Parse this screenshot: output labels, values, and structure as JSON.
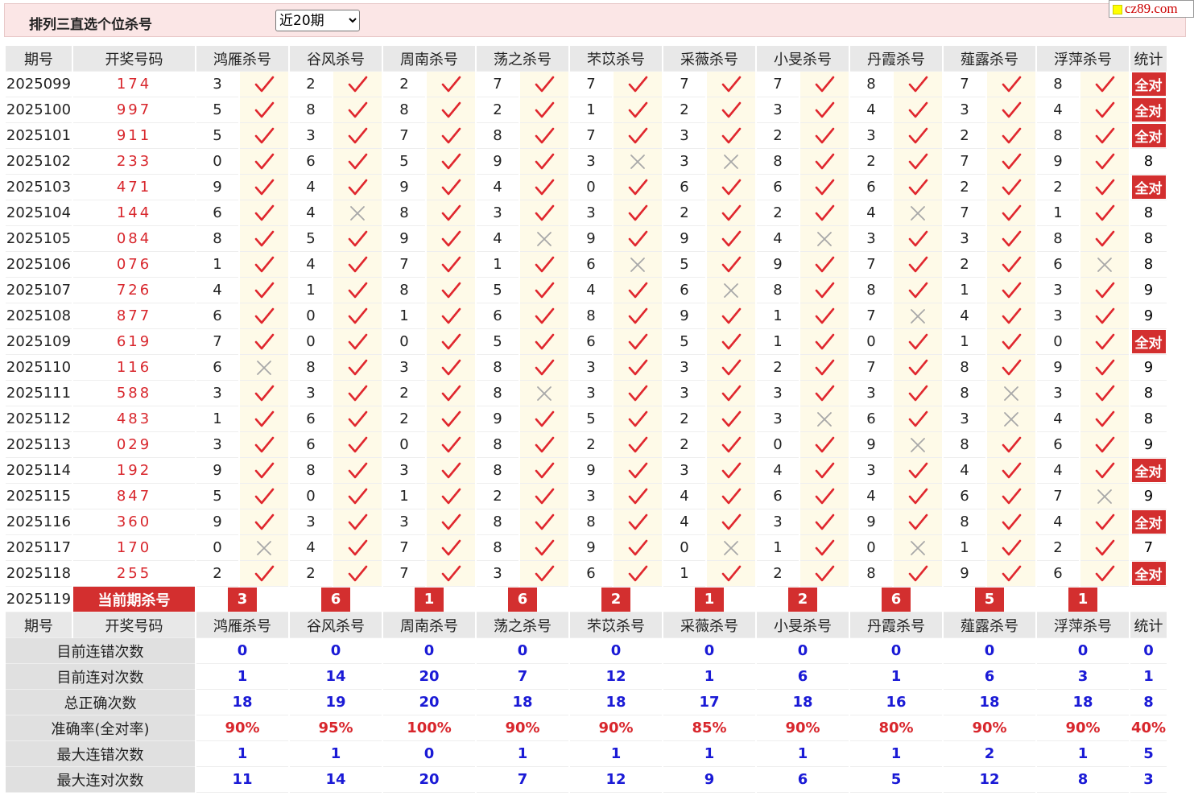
{
  "header": {
    "title": "排列三直选个位杀号",
    "range_selected": "近20期",
    "logo_text": "cz89.com"
  },
  "columns": {
    "period": "期号",
    "draw": "开奖号码",
    "predictors": [
      "鸿雁杀号",
      "谷风杀号",
      "周南杀号",
      "荡之杀号",
      "芣苡杀号",
      "采薇杀号",
      "小旻杀号",
      "丹霞杀号",
      "薤露杀号",
      "浮萍杀号"
    ],
    "stat": "统计"
  },
  "all_correct_label": "全对",
  "rows": [
    {
      "period": "2025099",
      "draw": "174",
      "kills": [
        3,
        2,
        2,
        7,
        7,
        7,
        7,
        8,
        7,
        8
      ],
      "ok": [
        1,
        1,
        1,
        1,
        1,
        1,
        1,
        1,
        1,
        1
      ],
      "stat": "全对"
    },
    {
      "period": "2025100",
      "draw": "997",
      "kills": [
        5,
        8,
        8,
        2,
        1,
        2,
        3,
        4,
        3,
        4
      ],
      "ok": [
        1,
        1,
        1,
        1,
        1,
        1,
        1,
        1,
        1,
        1
      ],
      "stat": "全对"
    },
    {
      "period": "2025101",
      "draw": "911",
      "kills": [
        5,
        3,
        7,
        8,
        7,
        3,
        2,
        3,
        2,
        8
      ],
      "ok": [
        1,
        1,
        1,
        1,
        1,
        1,
        1,
        1,
        1,
        1
      ],
      "stat": "全对"
    },
    {
      "period": "2025102",
      "draw": "233",
      "kills": [
        0,
        6,
        5,
        9,
        3,
        3,
        8,
        2,
        7,
        9
      ],
      "ok": [
        1,
        1,
        1,
        1,
        0,
        0,
        1,
        1,
        1,
        1
      ],
      "stat": "8"
    },
    {
      "period": "2025103",
      "draw": "471",
      "kills": [
        9,
        4,
        9,
        4,
        0,
        6,
        6,
        6,
        2,
        2
      ],
      "ok": [
        1,
        1,
        1,
        1,
        1,
        1,
        1,
        1,
        1,
        1
      ],
      "stat": "全对"
    },
    {
      "period": "2025104",
      "draw": "144",
      "kills": [
        6,
        4,
        8,
        3,
        3,
        2,
        2,
        4,
        7,
        1
      ],
      "ok": [
        1,
        0,
        1,
        1,
        1,
        1,
        1,
        0,
        1,
        1
      ],
      "stat": "8"
    },
    {
      "period": "2025105",
      "draw": "084",
      "kills": [
        8,
        5,
        9,
        4,
        9,
        9,
        4,
        3,
        3,
        8
      ],
      "ok": [
        1,
        1,
        1,
        0,
        1,
        1,
        0,
        1,
        1,
        1
      ],
      "stat": "8"
    },
    {
      "period": "2025106",
      "draw": "076",
      "kills": [
        1,
        4,
        7,
        1,
        6,
        5,
        9,
        7,
        2,
        6
      ],
      "ok": [
        1,
        1,
        1,
        1,
        0,
        1,
        1,
        1,
        1,
        0
      ],
      "stat": "8"
    },
    {
      "period": "2025107",
      "draw": "726",
      "kills": [
        4,
        1,
        8,
        5,
        4,
        6,
        8,
        8,
        1,
        3
      ],
      "ok": [
        1,
        1,
        1,
        1,
        1,
        0,
        1,
        1,
        1,
        1
      ],
      "stat": "9"
    },
    {
      "period": "2025108",
      "draw": "877",
      "kills": [
        6,
        0,
        1,
        6,
        8,
        9,
        1,
        7,
        4,
        3
      ],
      "ok": [
        1,
        1,
        1,
        1,
        1,
        1,
        1,
        0,
        1,
        1
      ],
      "stat": "9"
    },
    {
      "period": "2025109",
      "draw": "619",
      "kills": [
        7,
        0,
        0,
        5,
        6,
        5,
        1,
        0,
        1,
        0
      ],
      "ok": [
        1,
        1,
        1,
        1,
        1,
        1,
        1,
        1,
        1,
        1
      ],
      "stat": "全对"
    },
    {
      "period": "2025110",
      "draw": "116",
      "kills": [
        6,
        8,
        3,
        8,
        3,
        3,
        2,
        7,
        8,
        9
      ],
      "ok": [
        0,
        1,
        1,
        1,
        1,
        1,
        1,
        1,
        1,
        1
      ],
      "stat": "9"
    },
    {
      "period": "2025111",
      "draw": "588",
      "kills": [
        3,
        3,
        2,
        8,
        3,
        3,
        3,
        3,
        8,
        3
      ],
      "ok": [
        1,
        1,
        1,
        0,
        1,
        1,
        1,
        1,
        0,
        1
      ],
      "stat": "8"
    },
    {
      "period": "2025112",
      "draw": "483",
      "kills": [
        1,
        6,
        2,
        9,
        5,
        2,
        3,
        6,
        3,
        4
      ],
      "ok": [
        1,
        1,
        1,
        1,
        1,
        1,
        0,
        1,
        0,
        1
      ],
      "stat": "8"
    },
    {
      "period": "2025113",
      "draw": "029",
      "kills": [
        3,
        6,
        0,
        8,
        2,
        2,
        0,
        9,
        8,
        6
      ],
      "ok": [
        1,
        1,
        1,
        1,
        1,
        1,
        1,
        0,
        1,
        1
      ],
      "stat": "9"
    },
    {
      "period": "2025114",
      "draw": "192",
      "kills": [
        9,
        8,
        3,
        8,
        9,
        3,
        4,
        3,
        4,
        4
      ],
      "ok": [
        1,
        1,
        1,
        1,
        1,
        1,
        1,
        1,
        1,
        1
      ],
      "stat": "全对"
    },
    {
      "period": "2025115",
      "draw": "847",
      "kills": [
        5,
        0,
        1,
        2,
        3,
        4,
        6,
        4,
        6,
        7
      ],
      "ok": [
        1,
        1,
        1,
        1,
        1,
        1,
        1,
        1,
        1,
        0
      ],
      "stat": "9"
    },
    {
      "period": "2025116",
      "draw": "360",
      "kills": [
        9,
        3,
        3,
        8,
        8,
        4,
        3,
        9,
        8,
        4
      ],
      "ok": [
        1,
        1,
        1,
        1,
        1,
        1,
        1,
        1,
        1,
        1
      ],
      "stat": "全对"
    },
    {
      "period": "2025117",
      "draw": "170",
      "kills": [
        0,
        4,
        7,
        8,
        9,
        0,
        1,
        0,
        1,
        2
      ],
      "ok": [
        0,
        1,
        1,
        1,
        1,
        0,
        1,
        0,
        1,
        1
      ],
      "stat": "7"
    },
    {
      "period": "2025118",
      "draw": "255",
      "kills": [
        2,
        2,
        7,
        3,
        6,
        1,
        2,
        8,
        9,
        6
      ],
      "ok": [
        1,
        1,
        1,
        1,
        1,
        1,
        1,
        1,
        1,
        1
      ],
      "stat": "全对"
    }
  ],
  "current": {
    "period": "2025119",
    "label": "当前期杀号",
    "kills": [
      3,
      6,
      1,
      6,
      2,
      1,
      2,
      6,
      5,
      1
    ]
  },
  "stats": [
    {
      "label": "目前连错次数",
      "values": [
        "0",
        "0",
        "0",
        "0",
        "0",
        "0",
        "0",
        "0",
        "0",
        "0"
      ],
      "total": "0",
      "style": "blue"
    },
    {
      "label": "目前连对次数",
      "values": [
        "1",
        "14",
        "20",
        "7",
        "12",
        "1",
        "6",
        "1",
        "6",
        "3"
      ],
      "total": "1",
      "style": "blue"
    },
    {
      "label": "总正确次数",
      "values": [
        "18",
        "19",
        "20",
        "18",
        "18",
        "17",
        "18",
        "16",
        "18",
        "18"
      ],
      "total": "8",
      "style": "blue"
    },
    {
      "label": "准确率(全对率)",
      "values": [
        "90%",
        "95%",
        "100%",
        "90%",
        "90%",
        "85%",
        "90%",
        "80%",
        "90%",
        "90%"
      ],
      "total": "40%",
      "style": "red"
    },
    {
      "label": "最大连错次数",
      "values": [
        "1",
        "1",
        "0",
        "1",
        "1",
        "1",
        "1",
        "1",
        "2",
        "1"
      ],
      "total": "5",
      "style": "blue"
    },
    {
      "label": "最大连对次数",
      "values": [
        "11",
        "14",
        "20",
        "7",
        "12",
        "9",
        "6",
        "5",
        "12",
        "8"
      ],
      "total": "3",
      "style": "blue"
    }
  ],
  "colors": {
    "accent_red": "#d32f2f",
    "check_red": "#e0272e",
    "cross_gray": "#a8a8a8",
    "stat_blue": "#1a1ad6"
  }
}
